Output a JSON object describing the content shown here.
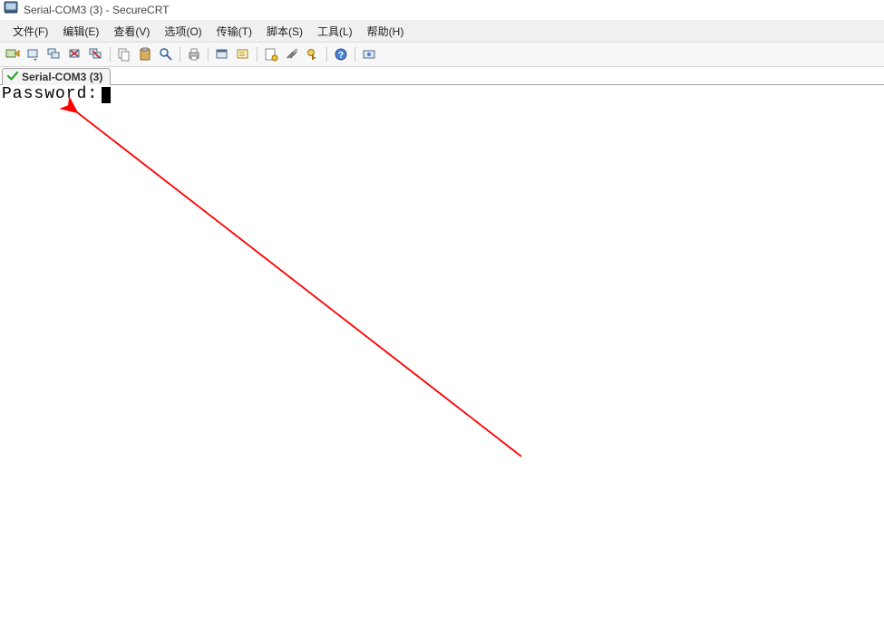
{
  "window": {
    "title": "Serial-COM3 (3) - SecureCRT"
  },
  "menus": {
    "file": "文件(F)",
    "edit": "编辑(E)",
    "view": "查看(V)",
    "options": "选项(O)",
    "transfer": "传输(T)",
    "script": "脚本(S)",
    "tools": "工具(L)",
    "help": "帮助(H)"
  },
  "toolbar_icons": [
    "quick-connect-icon",
    "reconnect-icon",
    "reconnect-all-icon",
    "disconnect-icon",
    "disconnect-all-icon",
    "sep",
    "copy-icon",
    "paste-icon",
    "find-icon",
    "sep",
    "print-icon",
    "sep",
    "session-manager-icon",
    "command-window-icon",
    "sep",
    "properties-icon",
    "settings-icon",
    "keymap-icon",
    "sep",
    "help-icon",
    "sep",
    "about-icon"
  ],
  "tab": {
    "label": "Serial-COM3 (3)"
  },
  "terminal": {
    "prompt": "Password:"
  },
  "annotation": {
    "arrow_color": "#ff0000"
  }
}
